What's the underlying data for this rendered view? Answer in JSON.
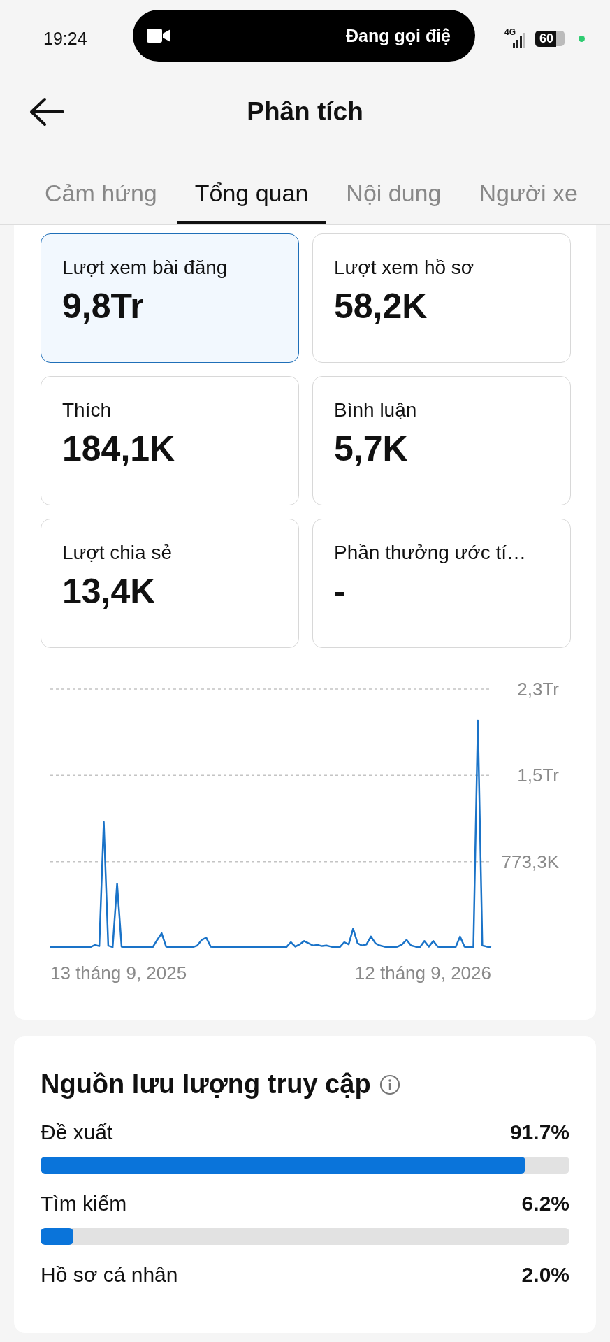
{
  "status_bar": {
    "time": "19:24",
    "call_text": "Đang gọi điệ",
    "network": "4G",
    "battery": "60"
  },
  "header": {
    "title": "Phân tích"
  },
  "tabs": [
    {
      "label": "Cảm hứng",
      "selected": false
    },
    {
      "label": "Tổng quan",
      "selected": true
    },
    {
      "label": "Nội dung",
      "selected": false
    },
    {
      "label": "Người xe",
      "selected": false
    }
  ],
  "metrics": [
    {
      "label": "Lượt xem bài đăng",
      "value": "9,8Tr",
      "selected": true
    },
    {
      "label": "Lượt xem hồ sơ",
      "value": "58,2K",
      "selected": false
    },
    {
      "label": "Thích",
      "value": "184,1K",
      "selected": false
    },
    {
      "label": "Bình luận",
      "value": "5,7K",
      "selected": false
    },
    {
      "label": "Lượt chia sẻ",
      "value": "13,4K",
      "selected": false
    },
    {
      "label": "Phần thưởng ước tí…",
      "value": "-",
      "selected": false
    }
  ],
  "chart": {
    "y_labels": [
      "2,3Tr",
      "1,5Tr",
      "773,3K"
    ],
    "x_labels": [
      "13 tháng 9, 2025",
      "12 tháng 9, 2026"
    ]
  },
  "traffic": {
    "title": "Nguồn lưu lượng truy cập",
    "sources": [
      {
        "label": "Đề xuất",
        "value": "91.7%",
        "level": 0.917
      },
      {
        "label": "Tìm kiếm",
        "value": "6.2%",
        "level": 0.062
      },
      {
        "label": "Hồ sơ cá nhân",
        "value": "2.0%"
      }
    ]
  }
}
